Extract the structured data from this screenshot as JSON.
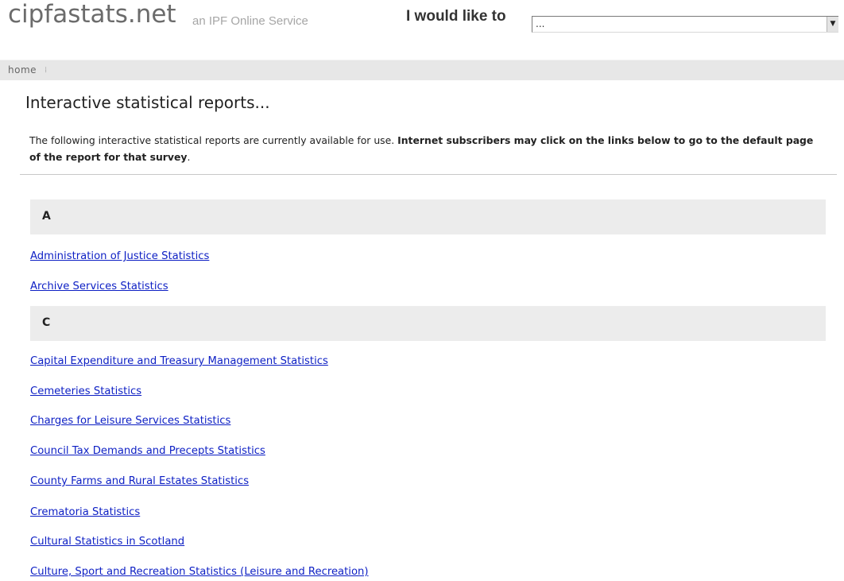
{
  "header": {
    "site_name": "cipfastats.net",
    "tagline": "an IPF Online Service",
    "would_like_label": "I would like to",
    "action_select": {
      "value": "...",
      "arrow": "▼"
    }
  },
  "breadcrumb": {
    "home": "home",
    "separator": "⁞"
  },
  "page": {
    "title": "Interactive statistical reports...",
    "intro_normal": "The following interactive statistical reports are currently available for use. ",
    "intro_bold": "Internet subscribers may click on the links below to go to the default page of the report for that survey",
    "intro_end": "."
  },
  "sections": [
    {
      "letter": "A",
      "links": [
        "Administration of Justice Statistics",
        "Archive Services Statistics"
      ]
    },
    {
      "letter": "C",
      "links": [
        "Capital Expenditure and Treasury Management Statistics",
        "Cemeteries Statistics",
        "Charges for Leisure Services Statistics",
        "Council Tax Demands and Precepts Statistics",
        "County Farms and Rural Estates Statistics",
        "Crematoria Statistics",
        "Cultural Statistics in Scotland",
        "Culture, Sport and Recreation Statistics (Leisure and Recreation)"
      ]
    }
  ],
  "colors": {
    "link": "#0d1fc4",
    "section_bar": "#ececec",
    "breadcrumb_bar": "#e7e7e7"
  }
}
